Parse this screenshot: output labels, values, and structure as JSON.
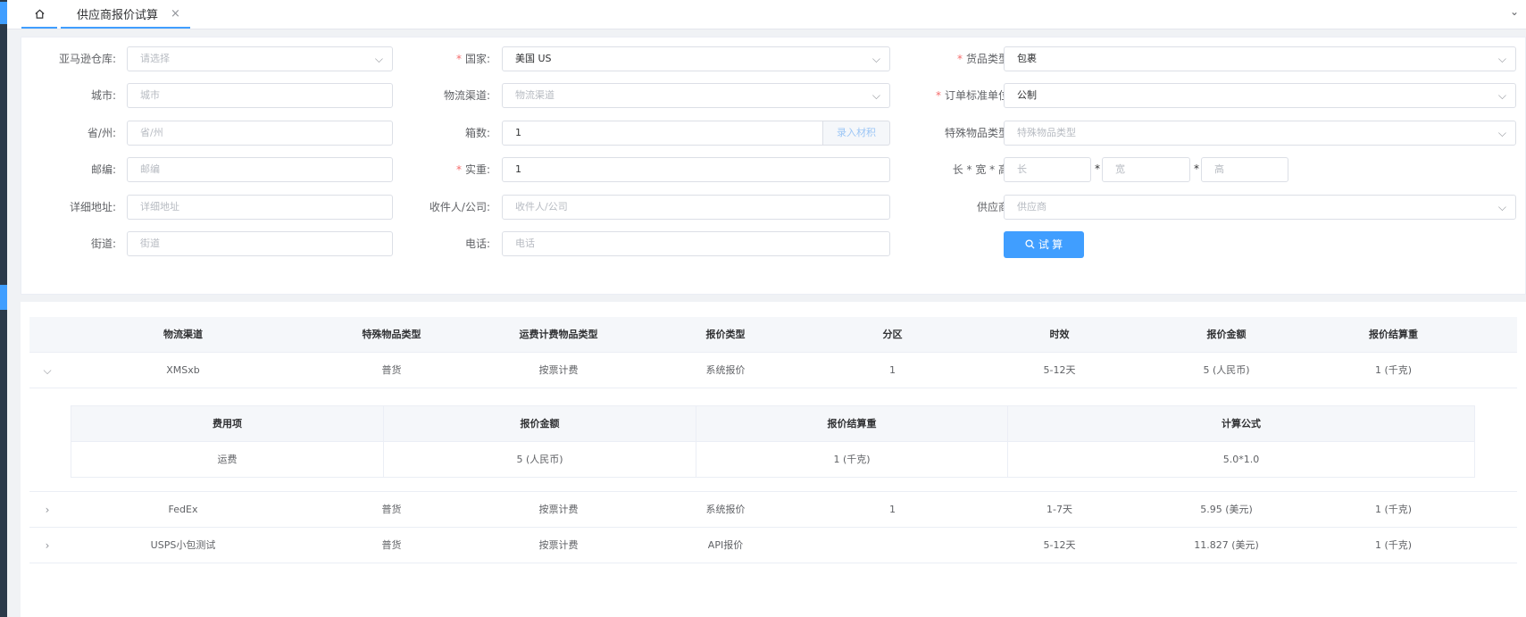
{
  "tabs": {
    "home_icon": "home-icon",
    "active_label": "供应商报价试算",
    "close_symbol": "×",
    "more_symbol": "⌄"
  },
  "form": {
    "warehouse": {
      "label": "亚马逊仓库:",
      "placeholder": "请选择"
    },
    "city": {
      "label": "城市:",
      "placeholder": "城市"
    },
    "province": {
      "label": "省/州:",
      "placeholder": "省/州"
    },
    "zipcode": {
      "label": "邮编:",
      "placeholder": "邮编"
    },
    "address": {
      "label": "详细地址:",
      "placeholder": "详细地址"
    },
    "street": {
      "label": "街道:",
      "placeholder": "街道"
    },
    "country": {
      "label": "国家:",
      "value": "美国 US",
      "required": "*"
    },
    "channel": {
      "label": "物流渠道:",
      "placeholder": "物流渠道"
    },
    "boxes": {
      "label": "箱数:",
      "value": "1",
      "append": "录入材积"
    },
    "weight": {
      "label": "实重:",
      "value": "1",
      "required": "*"
    },
    "receiver": {
      "label": "收件人/公司:",
      "placeholder": "收件人/公司"
    },
    "phone": {
      "label": "电话:",
      "placeholder": "电话"
    },
    "goods_type": {
      "label": "货品类型:",
      "value": "包裹",
      "required": "*"
    },
    "order_unit": {
      "label": "订单标准单位:",
      "value": "公制",
      "required": "*"
    },
    "special_type": {
      "label": "特殊物品类型:",
      "placeholder": "特殊物品类型"
    },
    "dimensions": {
      "label": "长 * 宽 * 高:",
      "length_ph": "长",
      "width_ph": "宽",
      "height_ph": "高",
      "sep": "*"
    },
    "supplier": {
      "label": "供应商:",
      "placeholder": "供应商"
    },
    "calc_button": "试 算"
  },
  "table": {
    "headers": [
      "物流渠道",
      "特殊物品类型",
      "运费计费物品类型",
      "报价类型",
      "分区",
      "时效",
      "报价金额",
      "报价结算重"
    ],
    "rows": [
      {
        "channel": "XMSxb",
        "special": "普货",
        "billing": "按票计费",
        "quote_type": "系统报价",
        "zone": "1",
        "time": "5-12天",
        "amount": "5 (人民币)",
        "weight": "1 (千克)"
      },
      {
        "channel": "FedEx",
        "special": "普货",
        "billing": "按票计费",
        "quote_type": "系统报价",
        "zone": "1",
        "time": "1-7天",
        "amount": "5.95 (美元)",
        "weight": "1 (千克)"
      },
      {
        "channel": "USPS小包测试",
        "special": "普货",
        "billing": "按票计费",
        "quote_type": "API报价",
        "zone": "",
        "time": "5-12天",
        "amount": "11.827 (美元)",
        "weight": "1 (千克)"
      }
    ],
    "sub_headers": [
      "费用项",
      "报价金额",
      "报价结算重",
      "计算公式"
    ],
    "sub_row": {
      "item": "运费",
      "amount": "5 (人民币)",
      "weight": "1 (千克)",
      "formula": "5.0*1.0"
    }
  }
}
